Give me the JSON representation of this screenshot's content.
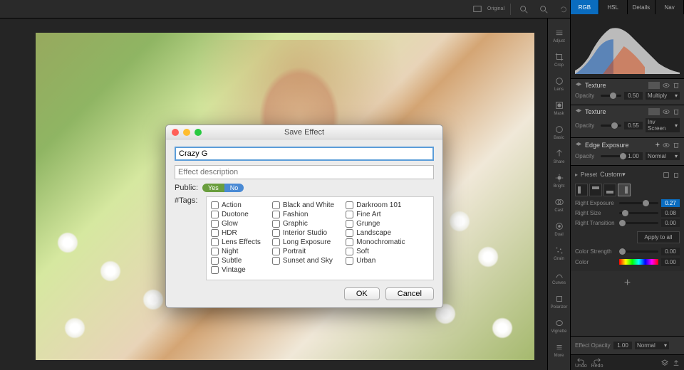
{
  "topbar": {
    "original": "Original",
    "in": "In",
    "out": "Out",
    "reset": "Reset"
  },
  "dialog": {
    "title": "Save Effect",
    "name_value": "Crazy G",
    "desc_placeholder": "Effect description",
    "public_label": "Public:",
    "yes": "Yes",
    "no": "No",
    "tags_label": "#Tags:",
    "col1": [
      "Action",
      "Duotone",
      "Glow",
      "HDR",
      "Lens Effects",
      "Night",
      "Subtle",
      "Vintage"
    ],
    "col2": [
      "Black and White",
      "Fashion",
      "Graphic",
      "Interior Studio",
      "Long Exposure",
      "Portrait",
      "Sunset and Sky"
    ],
    "col3": [
      "Darkroom 101",
      "Fine Art",
      "Grunge",
      "Landscape",
      "Monochromatic",
      "Soft",
      "Urban"
    ],
    "ok": "OK",
    "cancel": "Cancel"
  },
  "rail": [
    "Adjust",
    "Crop",
    "Lens",
    "Mask",
    "Basic",
    "Share",
    "Bright",
    "Cast",
    "Dual",
    "Grain",
    "Curves",
    "Polarizer",
    "Vignette",
    "More"
  ],
  "panel": {
    "tabs": [
      "RGB",
      "HSL",
      "Details",
      "Nav"
    ],
    "texture1": {
      "title": "Texture",
      "opacity_label": "Opacity",
      "opacity": "0.50",
      "blend": "Multiply"
    },
    "texture2": {
      "title": "Texture",
      "opacity_label": "Opacity",
      "opacity": "0.55",
      "blend": "Inv Screen"
    },
    "edge": {
      "title": "Edge Exposure",
      "opacity_label": "Opacity",
      "opacity": "1.00",
      "blend": "Normal"
    },
    "preset_label": "Preset",
    "preset_value": "Custom",
    "right_exposure": {
      "label": "Right Exposure",
      "val": "0.27"
    },
    "right_size": {
      "label": "Right Size",
      "val": "0.08"
    },
    "right_transition": {
      "label": "Right Transition",
      "val": "0.00"
    },
    "apply_all": "Apply to all",
    "color_strength": {
      "label": "Color Strength",
      "val": "0.00"
    },
    "color": {
      "label": "Color",
      "val": "0.00"
    },
    "add_effect": "+",
    "undo": "Undo",
    "redo": "Redo",
    "effect_opacity_label": "Effect Opacity",
    "effect_opacity_val": "1.00",
    "effect_blend": "Normal"
  }
}
